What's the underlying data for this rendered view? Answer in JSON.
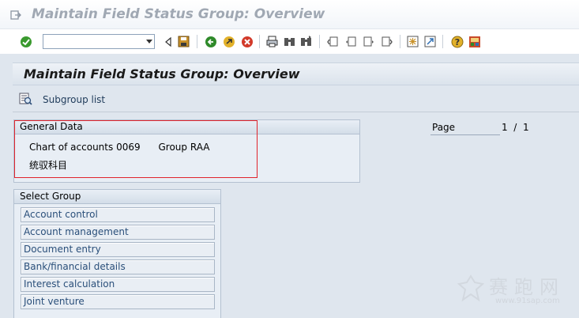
{
  "window": {
    "title": "Maintain Field Status Group: Overview"
  },
  "toolbar": {
    "command_field_value": "",
    "icons": [
      "enter-icon",
      "back-icon",
      "save-icon",
      "back-green-icon",
      "exit-yellow-icon",
      "cancel-icon",
      "print-icon",
      "find-icon",
      "find-next-icon",
      "first-page-icon",
      "previous-page-icon",
      "next-page-icon",
      "last-page-icon",
      "create-session-icon",
      "shortcut-icon",
      "help-icon",
      "customize-layout-icon"
    ],
    "colors": {
      "enter": "#3a9a2e",
      "back_green": "#2f8a2a",
      "exit_yellow": "#e2b12a",
      "cancel": "#d23a2a",
      "save": "#c9922b"
    }
  },
  "page": {
    "heading": "Maintain Field Status Group: Overview"
  },
  "app_toolbar": {
    "subgroup_list_label": "Subgroup list"
  },
  "general_data": {
    "title": "General Data",
    "chart_of_accounts_label": "Chart of accounts",
    "chart_of_accounts_value": "0069",
    "group_label": "Group",
    "group_value": "RAA",
    "description": "统驭科目",
    "highlight_color": "#e0242c"
  },
  "pagination": {
    "label": "Page",
    "current": "1",
    "separator": "/",
    "total": "1"
  },
  "select_group": {
    "title": "Select Group",
    "items": [
      "Account control",
      "Account management",
      "Document entry",
      "Bank/financial details",
      "Interest calculation",
      "Joint venture"
    ]
  },
  "watermark": {
    "text_cn": "赛跑网",
    "url": "www.91sap.com"
  }
}
